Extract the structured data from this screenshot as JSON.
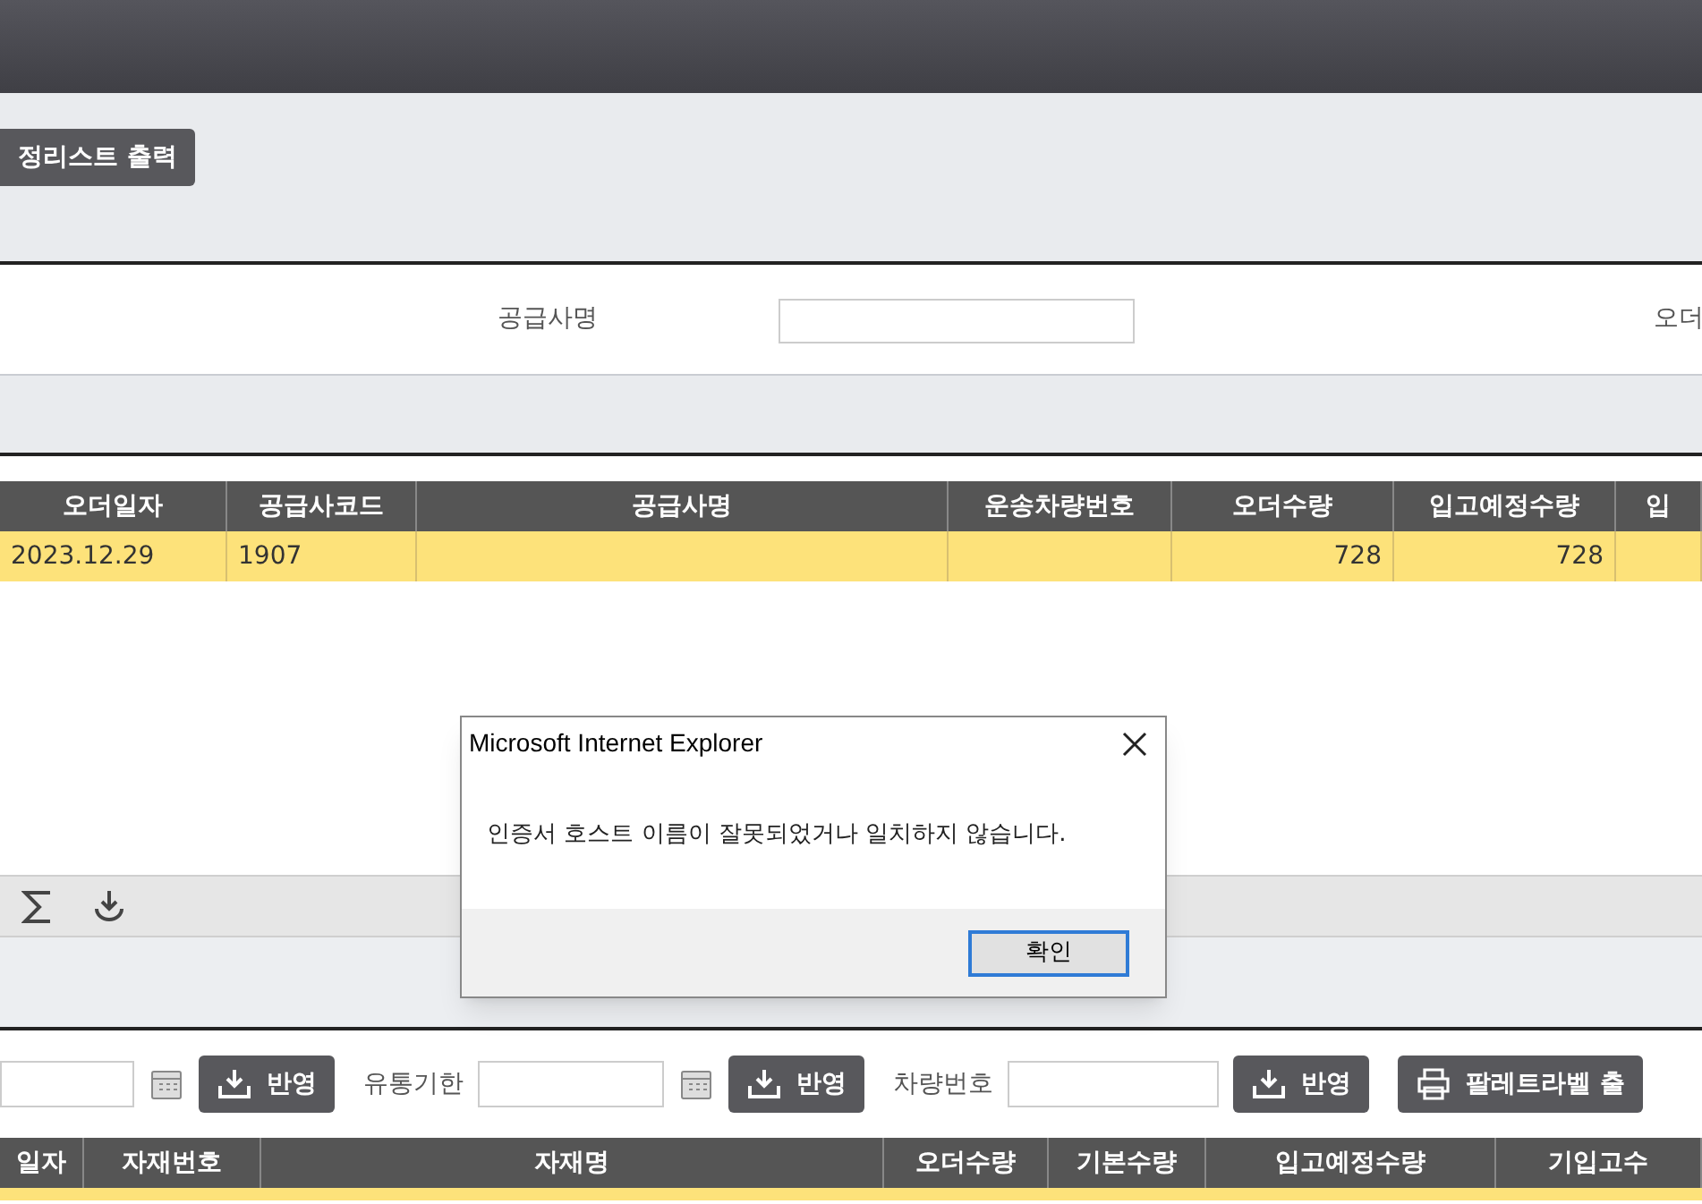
{
  "toolbar": {
    "buttons": [
      "정리스트 출력"
    ]
  },
  "search": {
    "fields": [
      {
        "label": "공급사명",
        "kind": "input"
      },
      {
        "label": "오더",
        "kind": "label"
      }
    ]
  },
  "order_table": {
    "columns": [
      "오더일자",
      "공급사코드",
      "공급사명",
      "운송차량번호",
      "오더수량",
      "입고예정수량",
      "입"
    ],
    "rows": [
      {
        "selected": true,
        "cells": [
          "2023.12.29",
          "1907",
          null,
          null,
          "728",
          "728",
          null
        ]
      }
    ]
  },
  "detail_filters": [
    {
      "kind": "date",
      "button": "반영"
    },
    {
      "kind": "date",
      "label": "유통기한",
      "button": "반영"
    },
    {
      "kind": "text",
      "label": "차량번호",
      "button": "반영"
    },
    {
      "kind": "print",
      "button": "팔레트라벨 출"
    }
  ],
  "detail_table": {
    "columns": [
      "일자",
      "자재번호",
      "자재명",
      "오더수량",
      "기본수량",
      "입고예정수량",
      "기입고수"
    ],
    "rows": [
      {
        "selected": true
      }
    ]
  },
  "dialog": {
    "title": "Microsoft Internet Explorer",
    "message": "인증서 호스트 이름이 잘못되었거나 일치하지 않습니다.",
    "buttons": [
      "확인"
    ]
  }
}
